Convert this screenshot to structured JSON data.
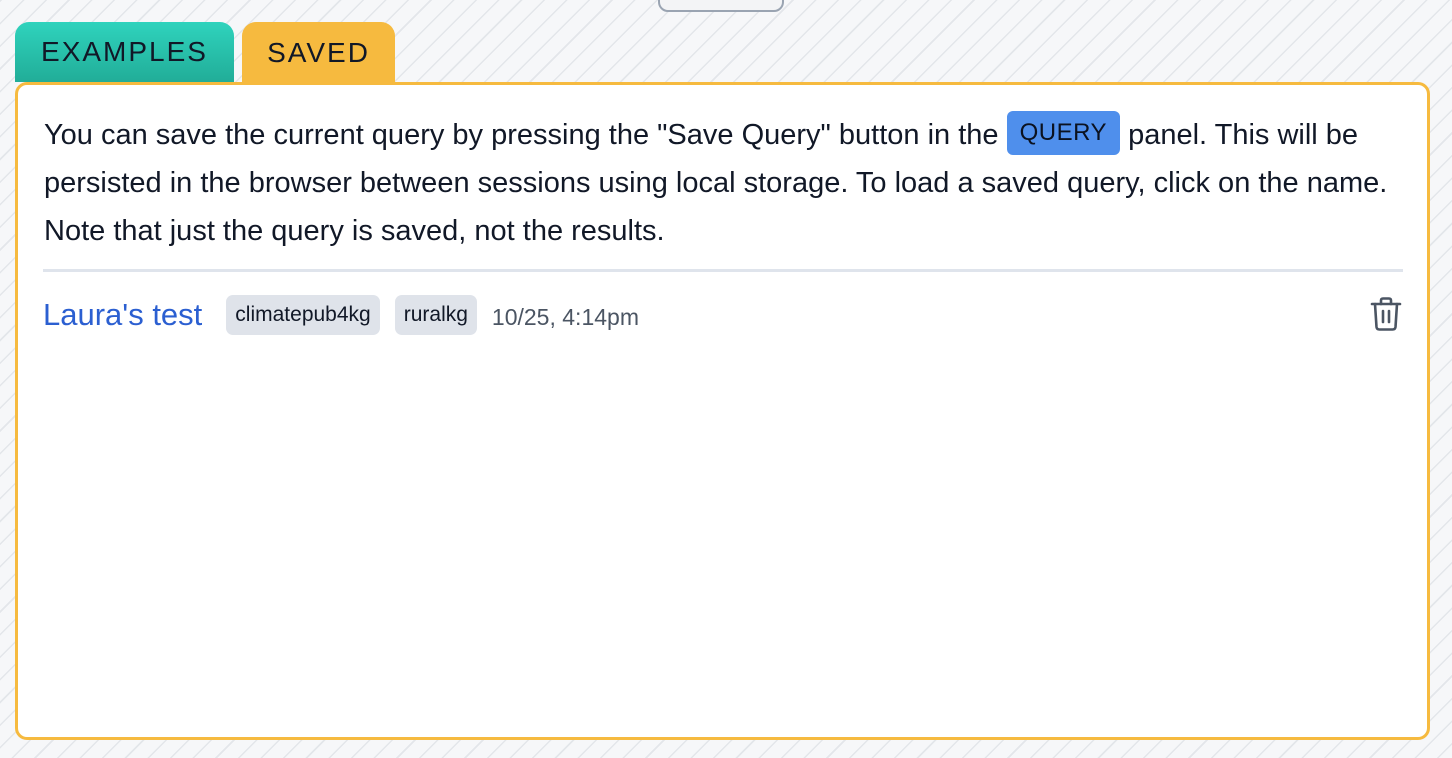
{
  "tabs": [
    {
      "label": "EXAMPLES",
      "active": false
    },
    {
      "label": "SAVED",
      "active": true
    }
  ],
  "saved_panel": {
    "intro_part1": "You can save the current query by pressing the \"Save Query\" button in the ",
    "query_badge": "QUERY",
    "intro_part2": " panel. This will be persisted in the browser between sessions using local storage. To load a saved query, click on the name. Note that just the query is saved, not the results.",
    "saved_queries": [
      {
        "name": "Laura's test",
        "tags": [
          "climatepub4kg",
          "ruralkg"
        ],
        "timestamp": "10/25, 4:14pm",
        "delete_icon": "trash-icon"
      }
    ]
  },
  "colors": {
    "examples_tab": "#2fd3bd",
    "saved_tab": "#f6ba3f",
    "panel_border": "#f6ba3f",
    "link": "#2b5fd1",
    "query_badge": "#4f8fec",
    "tag_bg": "#dfe3ea"
  }
}
